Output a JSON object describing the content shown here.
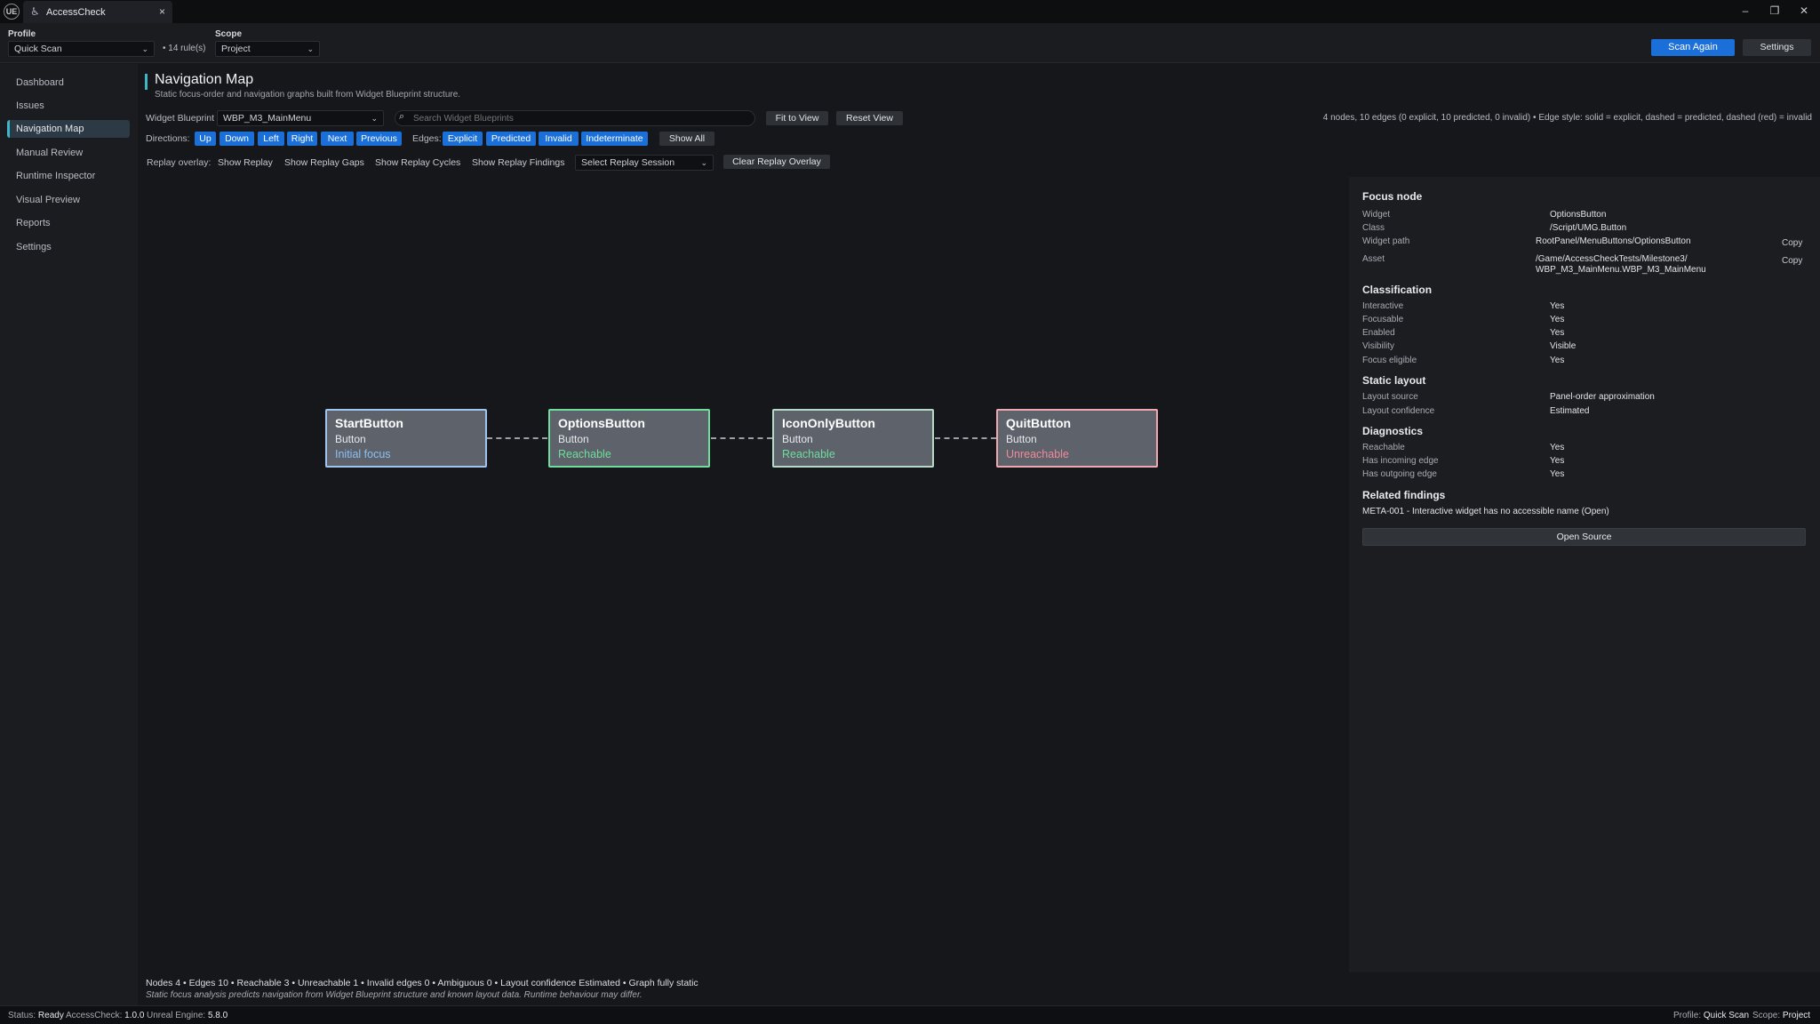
{
  "titlebar": {
    "logo": "UE",
    "tab_title": "AccessCheck",
    "tab_icon": "accessibility-icon",
    "tab_close": "×",
    "minimize": "–",
    "restore": "❐",
    "close": "✕"
  },
  "toolbar": {
    "profile_label": "Profile",
    "profile_value": "Quick Scan",
    "rules_count": "• 14 rule(s)",
    "scope_label": "Scope",
    "scope_value": "Project",
    "scan_again": "Scan Again",
    "settings": "Settings"
  },
  "sidebar": {
    "items": [
      {
        "label": "Dashboard",
        "active": false
      },
      {
        "label": "Issues",
        "active": false
      },
      {
        "label": "Navigation Map",
        "active": true
      },
      {
        "label": "Manual Review",
        "active": false
      },
      {
        "label": "Runtime Inspector",
        "active": false
      },
      {
        "label": "Visual Preview",
        "active": false
      },
      {
        "label": "Reports",
        "active": false
      },
      {
        "label": "Settings",
        "active": false
      }
    ]
  },
  "page": {
    "title": "Navigation Map",
    "subtitle": "Static focus-order and navigation graphs built from Widget Blueprint structure.",
    "accent_color": "#3fb6c8"
  },
  "controls": {
    "widget_blueprint_label": "Widget Blueprint",
    "widget_blueprint_value": "WBP_M3_MainMenu",
    "search_placeholder": "Search Widget Blueprints",
    "fit_to_view": "Fit to View",
    "reset_view": "Reset View",
    "graph_info": "4 nodes, 10 edges (0 explicit, 10 predicted, 0 invalid)  •  Edge style: solid = explicit, dashed = predicted, dashed (red) = invalid",
    "directions_label": "Directions:",
    "directions": [
      "Up",
      "Down",
      "Left",
      "Right",
      "Next",
      "Previous"
    ],
    "edges_label": "Edges:",
    "edges": [
      "Explicit",
      "Predicted",
      "Invalid",
      "Indeterminate"
    ],
    "show_all": "Show All",
    "replay_label": "Replay overlay:",
    "show_replay": "Show Replay",
    "show_replay_gaps": "Show Replay Gaps",
    "show_replay_cycles": "Show Replay Cycles",
    "show_replay_findings": "Show Replay Findings",
    "replay_session": "Select Replay Session",
    "clear_replay": "Clear Replay Overlay"
  },
  "graph": {
    "nodes": [
      {
        "name": "StartButton",
        "type": "Button",
        "status": "Initial focus",
        "border": "#9ec4ef",
        "status_color": "#8cc0f5"
      },
      {
        "name": "OptionsButton",
        "type": "Button",
        "status": "Reachable",
        "border": "#6fdd9c",
        "status_color": "#6fdd9c"
      },
      {
        "name": "IconOnlyButton",
        "type": "Button",
        "status": "Reachable",
        "border": "#b5dbc6",
        "status_color": "#6fdd9c"
      },
      {
        "name": "QuitButton",
        "type": "Button",
        "status": "Unreachable",
        "border": "#f0a8b0",
        "status_color": "#f08a98"
      }
    ]
  },
  "details": {
    "focus_node_heading": "Focus node",
    "widget_label": "Widget",
    "widget_value": "OptionsButton",
    "class_label": "Class",
    "class_value": "/Script/UMG.Button",
    "path_label": "Widget path",
    "path_value": "RootPanel/MenuButtons/OptionsButton",
    "asset_label": "Asset",
    "asset_value_1": "/Game/AccessCheckTests/Milestone3/",
    "asset_value_2": "WBP_M3_MainMenu.WBP_M3_MainMenu",
    "copy": "Copy",
    "classification_heading": "Classification",
    "classification": [
      {
        "key": "Interactive",
        "value": "Yes"
      },
      {
        "key": "Focusable",
        "value": "Yes"
      },
      {
        "key": "Enabled",
        "value": "Yes"
      },
      {
        "key": "Visibility",
        "value": "Visible"
      },
      {
        "key": "Focus eligible",
        "value": "Yes"
      }
    ],
    "static_layout_heading": "Static layout",
    "static_layout": [
      {
        "key": "Layout source",
        "value": "Panel-order approximation"
      },
      {
        "key": "Layout confidence",
        "value": "Estimated"
      }
    ],
    "diagnostics_heading": "Diagnostics",
    "diagnostics": [
      {
        "key": "Reachable",
        "value": "Yes"
      },
      {
        "key": "Has incoming edge",
        "value": "Yes"
      },
      {
        "key": "Has outgoing edge",
        "value": "Yes"
      }
    ],
    "related_heading": "Related findings",
    "related_finding": "META-001  -  Interactive widget has no accessible name (Open)",
    "open_source": "Open Source"
  },
  "footer": {
    "summary": "Nodes 4  •  Edges 10  •  Reachable 3  •  Unreachable 1  •  Invalid edges 0  •  Ambiguous 0  •  Layout confidence Estimated  •  Graph fully static",
    "disclaimer": "Static focus analysis predicts navigation from Widget Blueprint structure and known layout data. Runtime behaviour may differ."
  },
  "statusbar": {
    "status_label": "Status:",
    "status_value": "Ready",
    "version_label": "AccessCheck:",
    "version_value": "1.0.0",
    "engine_label": "Unreal Engine:",
    "engine_value": "5.8.0",
    "profile_label": "Profile:",
    "profile_value": "Quick Scan",
    "scope_label": "Scope:",
    "scope_value": "Project"
  }
}
